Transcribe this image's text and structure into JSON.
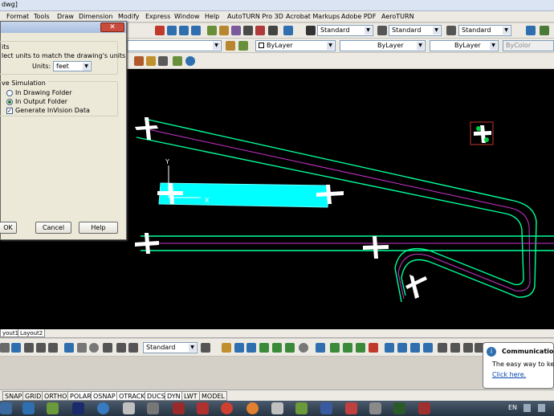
{
  "window": {
    "title": "dwg]"
  },
  "menu": [
    "Format",
    "Tools",
    "Draw",
    "Dimension",
    "Modify",
    "Express",
    "Window",
    "Help",
    "AutoTURN Pro 3D",
    "Acrobat Markups",
    "Adobe PDF",
    "AeroTURN"
  ],
  "toolbar": {
    "text_style": "Standard",
    "dim_style": "Standard",
    "table_style": "Standard",
    "layer_color": "ByLayer",
    "linetype": "ByLayer",
    "lineweight": "ByLayer",
    "plotstyle": "ByColor",
    "bottom_style": "Standard"
  },
  "dialog": {
    "units_group": "its",
    "units_desc": "lect units to match the drawing's units",
    "units_label": "Units:",
    "units_value": "feet",
    "sim_group": "ve Simulation",
    "opt_drawing": "In Drawing Folder",
    "opt_output": "In Output Folder",
    "opt_generate": "Generate InVision Data",
    "ok": "OK",
    "cancel": "Cancel",
    "help": "Help"
  },
  "layout_tabs": [
    "yout1",
    "Layout2"
  ],
  "status": [
    "SNAP",
    "GRID",
    "ORTHO",
    "POLAR",
    "OSNAP",
    "OTRACK",
    "DUCS",
    "DYN",
    "LWT",
    "MODEL"
  ],
  "notification": {
    "title": "Communication C",
    "body": "The easy way to keep yo",
    "link": "Click here."
  },
  "language": "EN",
  "ucs": {
    "y": "Y",
    "x": "X"
  },
  "colors": {
    "canvas": "#000000",
    "path_outer": "#00ff99",
    "path_center": "#cc33cc",
    "highlight": "#00ffff",
    "aircraft": "#ffffff"
  }
}
